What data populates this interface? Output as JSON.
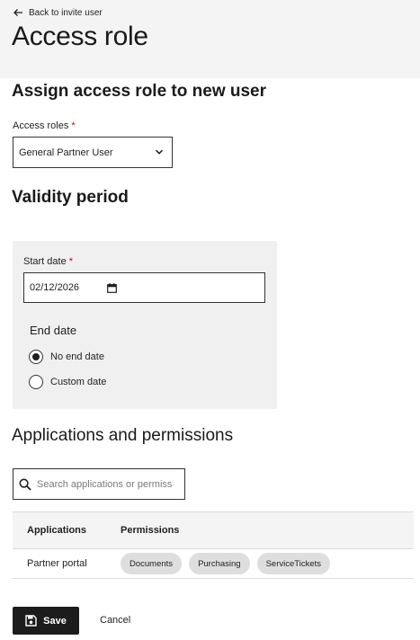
{
  "header": {
    "back_link": "Back to invite user",
    "back_icon": "arrow-left-icon",
    "title": "Access role"
  },
  "assign": {
    "heading": "Assign access role to new user",
    "roles_label": "Access roles",
    "required_mark": "*",
    "roles_value": "General Partner User",
    "roles_icon": "chevron-down-icon"
  },
  "validity": {
    "heading": "Validity period",
    "start_label": "Start date",
    "start_value": "02/12/2026",
    "calendar_icon": "calendar-icon",
    "end_label": "End date",
    "options": [
      {
        "label": "No end date",
        "selected": true
      },
      {
        "label": "Custom date",
        "selected": false
      }
    ]
  },
  "apps": {
    "heading": "Applications and permissions",
    "search_placeholder": "Search applications or permissions",
    "columns": [
      "Applications",
      "Permissions"
    ],
    "rows": [
      {
        "application": "Partner portal",
        "permissions": [
          "Documents",
          "Purchasing",
          "ServiceTickets"
        ]
      }
    ]
  },
  "actions": {
    "save": "Save",
    "save_icon": "save-icon",
    "cancel": "Cancel"
  },
  "colors": {
    "required": "#d0021b",
    "primary_button": "#1c1c1c",
    "panel": "#f0f0f0",
    "chip": "#dedede"
  }
}
